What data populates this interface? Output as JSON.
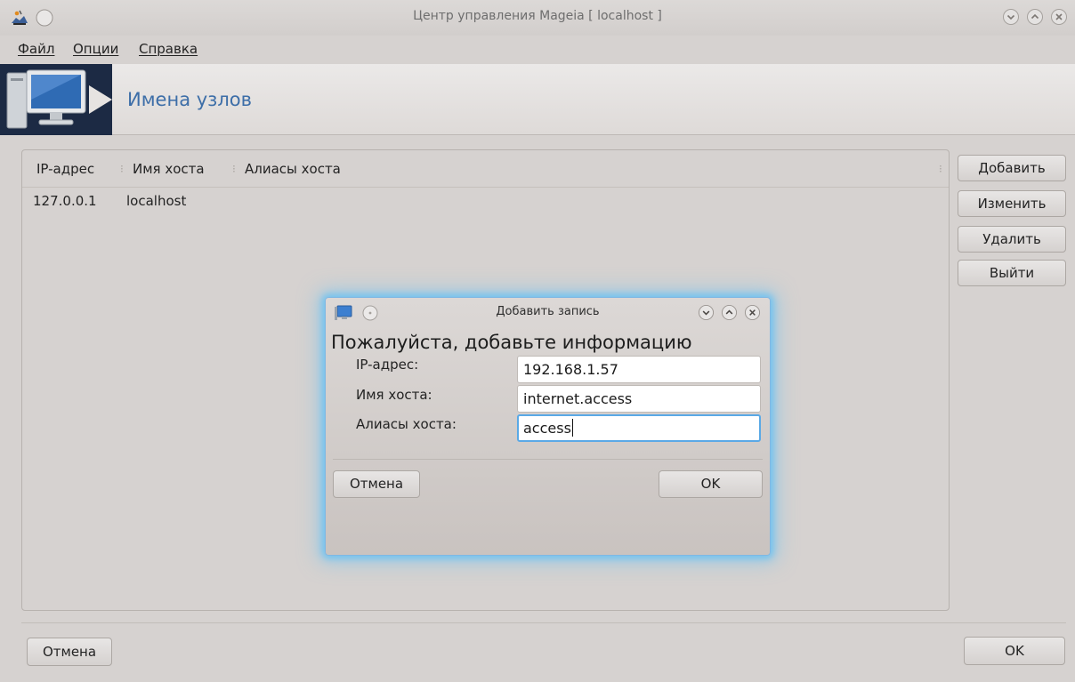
{
  "window": {
    "title": "Центр управления Mageia  [ localhost ]"
  },
  "menu": [
    {
      "label": "Файл"
    },
    {
      "label": "Опции"
    },
    {
      "label": "Справка"
    }
  ],
  "banner": {
    "title": "Имена узлов",
    "icon": "computer-monitor-icon"
  },
  "list": {
    "columns": [
      "IP-адрес",
      "Имя хоста",
      "Алиасы хоста"
    ],
    "rows": [
      {
        "ip": "127.0.0.1",
        "hostname": "localhost",
        "aliases": ""
      }
    ]
  },
  "side_buttons": {
    "add": "Добавить",
    "edit": "Изменить",
    "delete": "Удалить",
    "quit": "Выйти"
  },
  "footer": {
    "cancel": "Отмена",
    "ok": "OK"
  },
  "dialog": {
    "title": "Добавить запись",
    "heading": "Пожалуйста, добавьте информацию",
    "fields": {
      "ip": {
        "label": "IP-адрес:",
        "value": "192.168.1.57"
      },
      "hostname": {
        "label": "Имя хоста:",
        "value": "internet.access"
      },
      "aliases": {
        "label": "Алиасы хоста:",
        "value": "access"
      }
    },
    "cancel": "Отмена",
    "ok": "OK"
  },
  "colors": {
    "accent": "#3d6ea8",
    "banner_icon_bg": "#1c2a44",
    "dialog_glow": "#72c3f0"
  }
}
